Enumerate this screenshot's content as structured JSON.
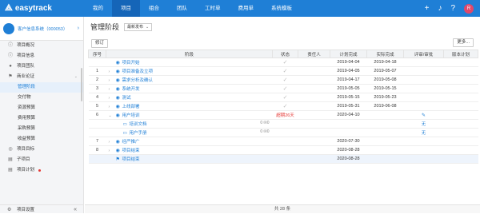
{
  "app": {
    "logo": "easytrack"
  },
  "topnav": [
    "我的",
    "项目",
    "组合",
    "团队",
    "工时单",
    "费用单",
    "系统模板"
  ],
  "project": {
    "name": "客户信息系统（000053）"
  },
  "sidebar": {
    "items": [
      {
        "label": "项目概况",
        "icon": "info-icon"
      },
      {
        "label": "项目信息",
        "icon": "info-icon"
      },
      {
        "label": "项目团队",
        "icon": "team-icon"
      },
      {
        "label": "商业论证",
        "icon": "flag-icon"
      }
    ],
    "subitems": [
      "管理阶段",
      "交付物",
      "资源预算",
      "费用预算",
      "采购预算",
      "收益预算"
    ],
    "items2": [
      {
        "label": "项目目标",
        "icon": "target-icon"
      },
      {
        "label": "子项目",
        "icon": "doc-icon"
      },
      {
        "label": "项目计划",
        "icon": "doc-icon"
      }
    ],
    "bottom": "项目设置"
  },
  "page": {
    "title": "管理阶段",
    "version": "最新发布",
    "edit_btn": "修订",
    "more_btn": "更多..."
  },
  "table": {
    "headers": [
      "序号",
      "阶段",
      "状态",
      "责任人",
      "计划完成",
      "实际完成",
      "评审/审批",
      "版本计划"
    ],
    "rows": [
      {
        "num": "",
        "exp": "",
        "type": "milestone",
        "name": "项目开始",
        "status": "✓",
        "owner": "",
        "planned": "2019-04-04",
        "actual": "2019-04-18",
        "review": "",
        "version": ""
      },
      {
        "num": "1",
        "exp": "›",
        "type": "milestone",
        "name": "项目准备及立项",
        "status": "✓",
        "owner": "",
        "planned": "2019-04-05",
        "actual": "2019-05-07",
        "review": "",
        "version": ""
      },
      {
        "num": "2",
        "exp": "›",
        "type": "milestone",
        "name": "需求分析及确认",
        "status": "✓",
        "owner": "",
        "planned": "2019-04-17",
        "actual": "2019-05-08",
        "review": "",
        "version": ""
      },
      {
        "num": "3",
        "exp": "›",
        "type": "milestone",
        "name": "系统开发",
        "status": "✓",
        "owner": "",
        "planned": "2019-05-05",
        "actual": "2019-05-15",
        "review": "",
        "version": ""
      },
      {
        "num": "4",
        "exp": "›",
        "type": "milestone",
        "name": "测试",
        "status": "✓",
        "owner": "",
        "planned": "2019-05-15",
        "actual": "2019-05-23",
        "review": "",
        "version": ""
      },
      {
        "num": "5",
        "exp": "›",
        "type": "milestone",
        "name": "上线部署",
        "status": "✓",
        "owner": "",
        "planned": "2019-05-31",
        "actual": "2019-06-08",
        "review": "",
        "version": ""
      },
      {
        "num": "6",
        "exp": "⌄",
        "type": "milestone",
        "name": "用户培训",
        "status": "超期26天",
        "owner": "",
        "planned": "2020-04-10",
        "actual": "",
        "review": "✎",
        "version": ""
      },
      {
        "num": "",
        "exp": "",
        "type": "doc",
        "name": "培训文档",
        "attach": "0 ✉0",
        "status": "",
        "owner": "",
        "planned": "",
        "actual": "",
        "review": "无",
        "version": ""
      },
      {
        "num": "",
        "exp": "",
        "type": "doc",
        "name": "用户手册",
        "attach": "0 ✉0",
        "status": "",
        "owner": "",
        "planned": "",
        "actual": "",
        "review": "无",
        "version": ""
      },
      {
        "num": "7",
        "exp": "›",
        "type": "milestone",
        "name": "经严推广",
        "status": "",
        "owner": "",
        "planned": "2020-07-30",
        "actual": "",
        "review": "",
        "version": ""
      },
      {
        "num": "8",
        "exp": "›",
        "type": "milestone",
        "name": "项目结束",
        "status": "",
        "owner": "",
        "planned": "2020-08-28",
        "actual": "",
        "review": "",
        "version": ""
      },
      {
        "num": "",
        "exp": "",
        "type": "flag",
        "name": "项目结束",
        "status": "",
        "owner": "",
        "planned": "2020-08-28",
        "actual": "",
        "review": "",
        "version": ""
      }
    ]
  },
  "footer": {
    "total": "共 28 条"
  },
  "colors": {
    "primary": "#1f7fd6",
    "warn": "#e53935"
  }
}
